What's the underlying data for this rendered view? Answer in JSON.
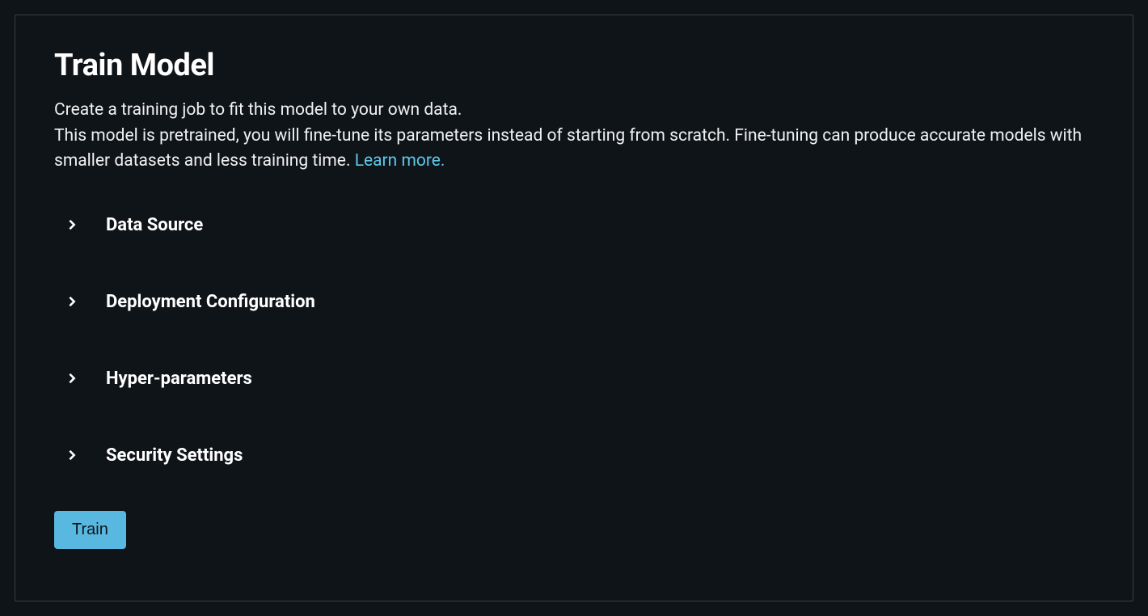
{
  "page": {
    "title": "Train Model",
    "description_line1": "Create a training job to fit this model to your own data.",
    "description_line2_part1": "This model is pretrained, you will fine-tune its parameters instead of starting from scratch. Fine-tuning can produce accurate models with smaller datasets and less training time. ",
    "learn_more_label": "Learn more."
  },
  "sections": [
    {
      "label": "Data Source"
    },
    {
      "label": "Deployment Configuration"
    },
    {
      "label": "Hyper-parameters"
    },
    {
      "label": "Security Settings"
    }
  ],
  "actions": {
    "train_label": "Train"
  }
}
